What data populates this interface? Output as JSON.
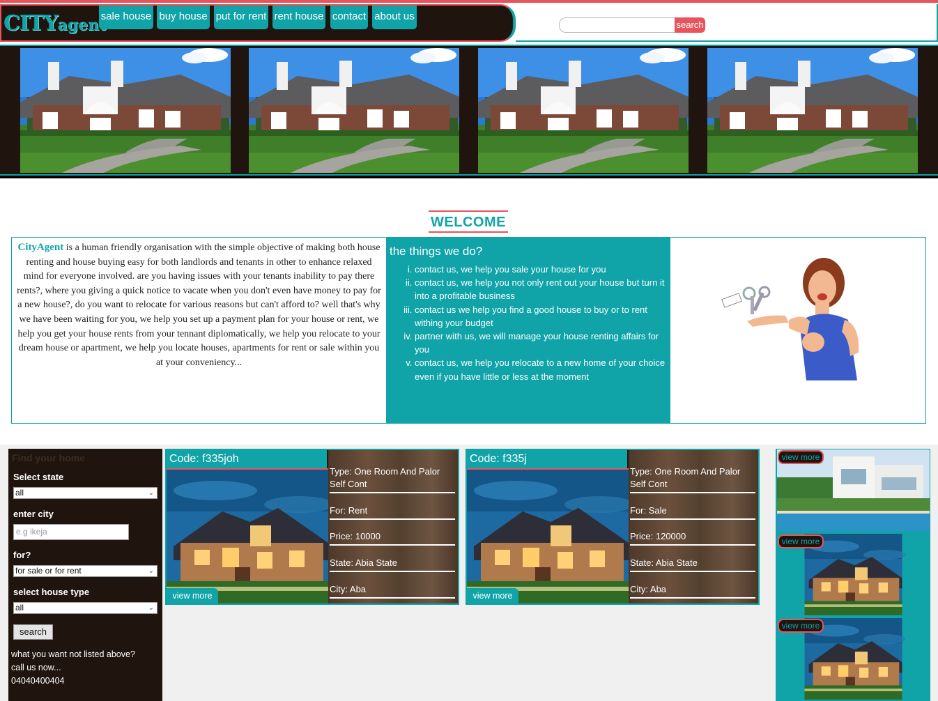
{
  "header": {
    "logo_city": "CITY",
    "logo_agent": "agent",
    "nav": [
      "sale house",
      "buy house",
      "put for rent",
      "rent house",
      "contact",
      "about us"
    ],
    "search_button": "search",
    "search_placeholder": ""
  },
  "welcome": {
    "title": "WELCOME",
    "brand": "CityAgent",
    "about": " is a human friendly organisation with the simple objective of making both house renting and house buying easy for both landlords and tenants in other to enhance relaxed mind for everyone involved. are you having issues with your tenants inability to pay there rents?, where you giving a quick notice to vacate when you don't even have money to pay for a new house?, do you want to relocate for various reasons but can't afford to? well that's why we have been waiting for you, we help you set up a payment plan for your house or rent, we help you get your house rents from your tennant diplomatically, we help you relocate to your dream house or apartment, we help you locate houses, apartments for rent or sale within you at your conveniency...",
    "things_title": "the things we do?",
    "things": [
      "contact us, we help you sale your house for you",
      "contact us, we help you not only rent out your house but turn it into a profitable business",
      "contact us we help you find a good house to buy or to rent withing your budget",
      "partner with us, we will manage your house renting affairs for you",
      "contact us, we help you relocate to a new home of your choice even if you have little or less at the moment"
    ]
  },
  "finder": {
    "title": "Find your home",
    "state_label": "Select state",
    "state_value": "all",
    "city_label": "enter city",
    "city_placeholder": "e.g ikeja",
    "for_label": "for?",
    "for_value": "for sale or for rent",
    "type_label": "select house type",
    "type_value": "all",
    "search_label": "search",
    "note_line1": "what you want not listed above?",
    "note_line2": "call us now...",
    "phone": "04040400404"
  },
  "listings": [
    {
      "code": "Code: f335joh",
      "type": "Type: One Room And Palor Self Cont",
      "for": "For: Rent",
      "price": "Price: 10000",
      "state": "State: Abia State",
      "city": "City: Aba",
      "view": "view more"
    },
    {
      "code": "Code: f335j",
      "type": "Type: One Room And Palor Self Cont",
      "for": "For: Sale",
      "price": "Price: 120000",
      "state": "State: Abia State",
      "city": "City: Aba",
      "view": "view more"
    }
  ],
  "side_thumbs": [
    "view more",
    "view more",
    "view more"
  ],
  "colors": {
    "teal": "#10a3a8",
    "coral": "#e8545b",
    "dark_brown": "#1f150e"
  }
}
